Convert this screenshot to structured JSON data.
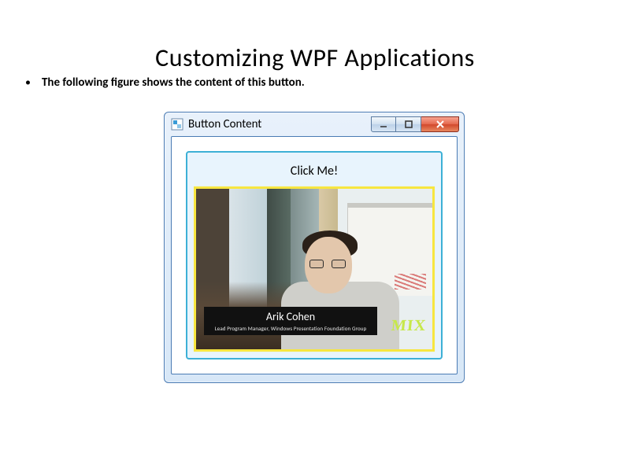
{
  "slide": {
    "title": "Customizing WPF Applications",
    "bullet": "The following figure shows the content of this button."
  },
  "window": {
    "title": "Button Content",
    "icon_name": "app-icon",
    "controls": {
      "minimize_name": "minimize-icon",
      "maximize_name": "maximize-icon",
      "close_name": "close-icon"
    }
  },
  "button": {
    "label": "Click Me!",
    "media": {
      "caption_name": "Arik Cohen",
      "caption_role": "Lead Program Manager, Windows Presentation Foundation Group",
      "badge": "MIX"
    }
  },
  "colors": {
    "window_border": "#4a7bb4",
    "button_border": "#3db0d6",
    "media_border": "#f7e640",
    "close_red": "#d2492c"
  }
}
